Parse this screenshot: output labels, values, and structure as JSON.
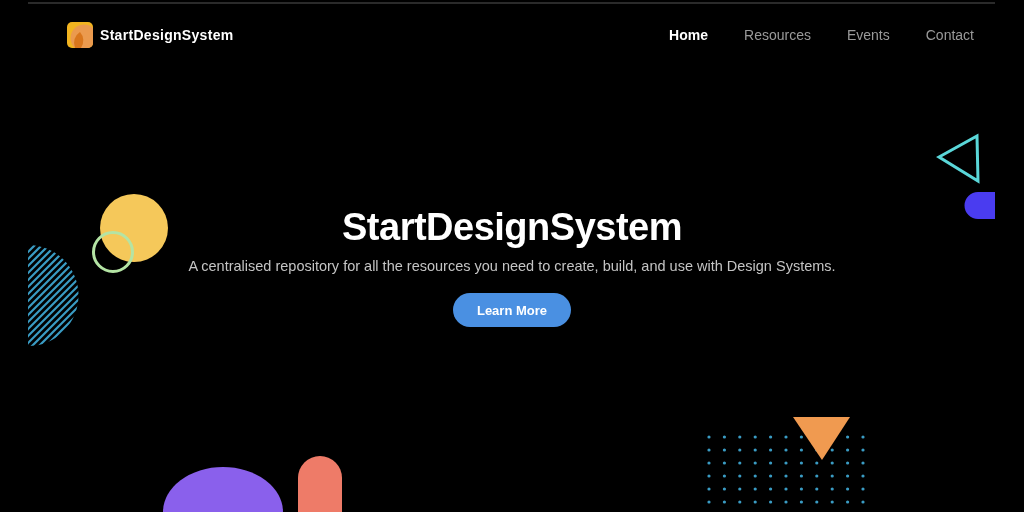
{
  "logo": {
    "text": "StartDesignSystem"
  },
  "nav": [
    {
      "label": "Home",
      "selected": true
    },
    {
      "label": "Resources",
      "selected": false
    },
    {
      "label": "Events",
      "selected": false
    },
    {
      "label": "Contact",
      "selected": false
    }
  ],
  "hero": {
    "title": "StartDesignSystem",
    "subtitle": "A centralised repository for all the resources you need to create, build, and use with Design Systems.",
    "button": "Learn More"
  }
}
